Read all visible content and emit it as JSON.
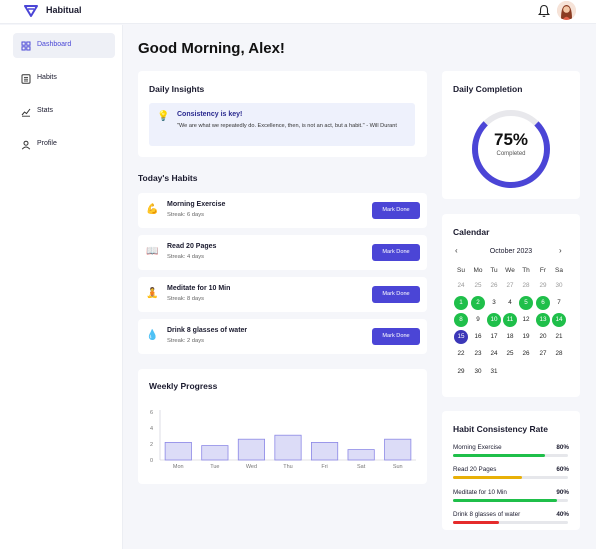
{
  "app": {
    "title": "Habitual"
  },
  "sidebar": {
    "items": [
      {
        "label": "Dashboard",
        "icon": "grid-icon",
        "active": true
      },
      {
        "label": "Habits",
        "icon": "list-icon",
        "active": false
      },
      {
        "label": "Stats",
        "icon": "chart-icon",
        "active": false
      },
      {
        "label": "Profile",
        "icon": "user-icon",
        "active": false
      }
    ]
  },
  "main": {
    "greeting": "Good Morning, Alex!",
    "insights": {
      "title": "Daily Insights",
      "quote_title": "Consistency is key!",
      "quote_text": "\"We are what we repeatedly do. Excellence, then, is not an act, but a habit.\" - Will Durant"
    },
    "habits_title": "Today's Habits",
    "habits": [
      {
        "emoji": "💪",
        "name": "Morning Exercise",
        "streak": "Streak: 6 days",
        "button": "Mark Done"
      },
      {
        "emoji": "📖",
        "name": "Read 20 Pages",
        "streak": "Streak: 4 days",
        "button": "Mark Done"
      },
      {
        "emoji": "🧘",
        "name": "Meditate for 10 Min",
        "streak": "Streak: 8 days",
        "button": "Mark Done"
      },
      {
        "emoji": "💧",
        "name": "Drink 8 glasses of water",
        "streak": "Streak: 2 days",
        "button": "Mark Done"
      }
    ],
    "weekly": {
      "title": "Weekly Progress"
    }
  },
  "completion": {
    "title": "Daily Completion",
    "value": 75,
    "label": "75%",
    "sub": "Completed"
  },
  "calendar": {
    "title": "Calendar",
    "prev": "‹",
    "next": "›",
    "month": "October 2023",
    "weekdays": [
      "Su",
      "Mo",
      "Tu",
      "We",
      "Th",
      "Fr",
      "Sa"
    ],
    "days": [
      [
        "24",
        "other"
      ],
      [
        "25",
        "other"
      ],
      [
        "26",
        "other"
      ],
      [
        "27",
        "other"
      ],
      [
        "28",
        "other"
      ],
      [
        "29",
        "other"
      ],
      [
        "30",
        "other"
      ],
      [
        "1",
        "done"
      ],
      [
        "2",
        "done"
      ],
      [
        "3",
        "cur"
      ],
      [
        "4",
        "cur"
      ],
      [
        "5",
        "done"
      ],
      [
        "6",
        "done"
      ],
      [
        "7",
        "cur"
      ],
      [
        "8",
        "done"
      ],
      [
        "9",
        "cur"
      ],
      [
        "10",
        "done"
      ],
      [
        "11",
        "done"
      ],
      [
        "12",
        "cur"
      ],
      [
        "13",
        "done"
      ],
      [
        "14",
        "done"
      ],
      [
        "15",
        "today"
      ],
      [
        "16",
        "cur"
      ],
      [
        "17",
        "cur"
      ],
      [
        "18",
        "cur"
      ],
      [
        "19",
        "cur"
      ],
      [
        "20",
        "cur"
      ],
      [
        "21",
        "cur"
      ],
      [
        "22",
        "cur"
      ],
      [
        "23",
        "cur"
      ],
      [
        "24",
        "cur"
      ],
      [
        "25",
        "cur"
      ],
      [
        "26",
        "cur"
      ],
      [
        "27",
        "cur"
      ],
      [
        "28",
        "cur"
      ],
      [
        "29",
        "cur"
      ],
      [
        "30",
        "cur"
      ],
      [
        "31",
        "cur"
      ]
    ]
  },
  "consistency": {
    "title": "Habit Consistency Rate",
    "items": [
      {
        "name": "Morning Exercise",
        "pct": "80%",
        "value": 0.8,
        "color": "#1fbf4a"
      },
      {
        "name": "Read 20 Pages",
        "pct": "60%",
        "value": 0.6,
        "color": "#e8b007"
      },
      {
        "name": "Meditate for 10 Min",
        "pct": "90%",
        "value": 0.9,
        "color": "#1fbf4a"
      },
      {
        "name": "Drink 8 glasses of water",
        "pct": "40%",
        "value": 0.4,
        "color": "#e52b2b"
      }
    ]
  },
  "colors": {
    "accent": "#4b45d6",
    "done": "#1fbf4a",
    "bar_fill": "#dcdcf7",
    "bar_stroke": "#8c88e6"
  },
  "chart_data": {
    "type": "bar",
    "categories": [
      "Mon",
      "Tue",
      "Wed",
      "Thu",
      "Fri",
      "Sat",
      "Sun"
    ],
    "values": [
      2.2,
      1.8,
      2.6,
      3.1,
      2.2,
      1.3,
      2.6
    ],
    "yticks": [
      "0",
      "2",
      "4",
      "6"
    ],
    "ylim": [
      0,
      6
    ],
    "title": "Weekly Progress",
    "xlabel": "",
    "ylabel": ""
  }
}
